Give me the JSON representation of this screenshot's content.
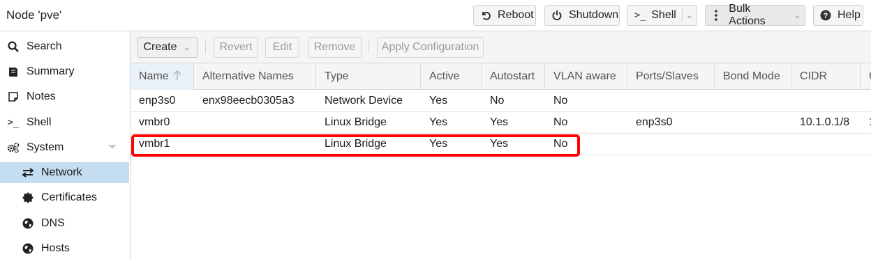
{
  "header": {
    "title": "Node 'pve'",
    "buttons": {
      "reboot": "Reboot",
      "shutdown": "Shutdown",
      "shell": "Shell",
      "bulk": "Bulk Actions",
      "help": "Help"
    }
  },
  "sidebar": {
    "items": [
      {
        "label": "Search",
        "icon": "search-icon"
      },
      {
        "label": "Summary",
        "icon": "book-icon"
      },
      {
        "label": "Notes",
        "icon": "note-icon"
      },
      {
        "label": "Shell",
        "icon": "terminal-icon"
      },
      {
        "label": "System",
        "icon": "gears-icon"
      },
      {
        "label": "Network",
        "icon": "exchange-icon"
      },
      {
        "label": "Certificates",
        "icon": "certificate-icon"
      },
      {
        "label": "DNS",
        "icon": "globe-icon"
      },
      {
        "label": "Hosts",
        "icon": "globe-icon"
      }
    ],
    "active": "Network"
  },
  "toolbar": {
    "create": "Create",
    "revert": "Revert",
    "edit": "Edit",
    "remove": "Remove",
    "apply": "Apply Configuration"
  },
  "grid": {
    "columns": [
      "Name",
      "Alternative Names",
      "Type",
      "Active",
      "Autostart",
      "VLAN aware",
      "Ports/Slaves",
      "Bond Mode",
      "CIDR",
      "G"
    ],
    "rows": [
      {
        "name": "enp3s0",
        "alt": "enx98eecb0305a3",
        "type": "Network Device",
        "active": "Yes",
        "autostart": "No",
        "vlan": "No",
        "ports": "",
        "bond": "",
        "cidr": "",
        "gw": ""
      },
      {
        "name": "vmbr0",
        "alt": "",
        "type": "Linux Bridge",
        "active": "Yes",
        "autostart": "Yes",
        "vlan": "No",
        "ports": "enp3s0",
        "bond": "",
        "cidr": "10.1.0.1/8",
        "gw": "1"
      },
      {
        "name": "vmbr1",
        "alt": "",
        "type": "Linux Bridge",
        "active": "Yes",
        "autostart": "Yes",
        "vlan": "No",
        "ports": "",
        "bond": "",
        "cidr": "",
        "gw": ""
      }
    ]
  },
  "colors": {
    "highlight": "#ff0000",
    "active_nav": "#c4ddf1"
  }
}
